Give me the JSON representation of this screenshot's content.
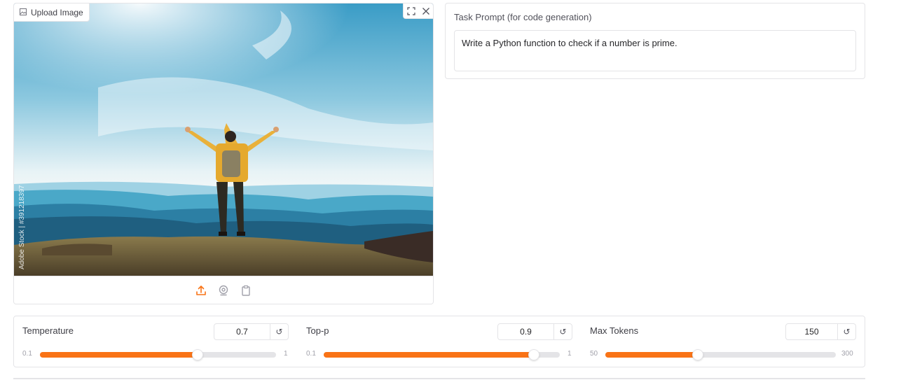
{
  "image_input": {
    "label": "Upload Image",
    "watermark": "Adobe Stock | #391218397",
    "sources": [
      "upload-icon",
      "webcam-icon",
      "clipboard-icon"
    ],
    "tools": [
      "fullscreen-icon",
      "close-icon"
    ]
  },
  "prompt": {
    "label": "Task Prompt (for code generation)",
    "value": "Write a Python function to check if a number is prime."
  },
  "sliders": [
    {
      "label": "Temperature",
      "value": "0.7",
      "min": "0.1",
      "max": "1",
      "fraction": 0.667
    },
    {
      "label": "Top-p",
      "value": "0.9",
      "min": "0.1",
      "max": "1",
      "fraction": 0.889
    },
    {
      "label": "Max Tokens",
      "value": "150",
      "min": "50",
      "max": "300",
      "fraction": 0.4
    }
  ],
  "colors": {
    "accent": "#f97316",
    "border": "#e4e4e7",
    "track": "#e4e4e7"
  }
}
